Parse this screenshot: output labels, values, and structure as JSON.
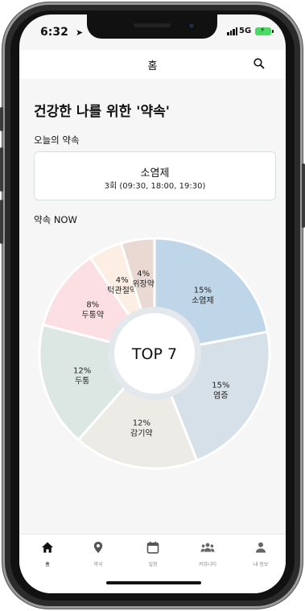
{
  "status": {
    "time": "6:32",
    "network": "5G"
  },
  "appbar": {
    "title": "홈"
  },
  "headline": "건강한 나를 위한 '약속'",
  "today": {
    "section_title": "오늘의 약속",
    "medicine": "소염제",
    "times": "3회 (09:30, 18:00, 19:30)"
  },
  "now": {
    "section_title": "약속 NOW",
    "center_label": "TOP 7"
  },
  "chart_data": {
    "type": "pie",
    "title": "",
    "center_label": "TOP 7",
    "slices": [
      {
        "label": "소염제",
        "percent_text": "15%",
        "value": 22,
        "color": "#bfd5e8"
      },
      {
        "label": "염증",
        "percent_text": "15%",
        "value": 22,
        "color": "#d5e0e8"
      },
      {
        "label": "감기약",
        "percent_text": "12%",
        "value": 17.5,
        "color": "#ecebe6"
      },
      {
        "label": "두통",
        "percent_text": "12%",
        "value": 17.5,
        "color": "#dce6e2"
      },
      {
        "label": "두통약",
        "percent_text": "8%",
        "value": 11.6,
        "color": "#fbdfe2"
      },
      {
        "label": "턱관절약",
        "percent_text": "4%",
        "value": 4.7,
        "color": "#fdeee3"
      },
      {
        "label": "위장약",
        "percent_text": "4%",
        "value": 4.7,
        "color": "#ead9d2"
      }
    ]
  },
  "pager": {
    "count": 2,
    "active": 0
  },
  "tabbar": {
    "items": [
      {
        "label": "홈",
        "icon": "home-icon"
      },
      {
        "label": "약국",
        "icon": "map-pin-icon"
      },
      {
        "label": "일정",
        "icon": "calendar-icon"
      },
      {
        "label": "커뮤니티",
        "icon": "people-icon"
      },
      {
        "label": "내 정보",
        "icon": "person-icon"
      }
    ]
  }
}
